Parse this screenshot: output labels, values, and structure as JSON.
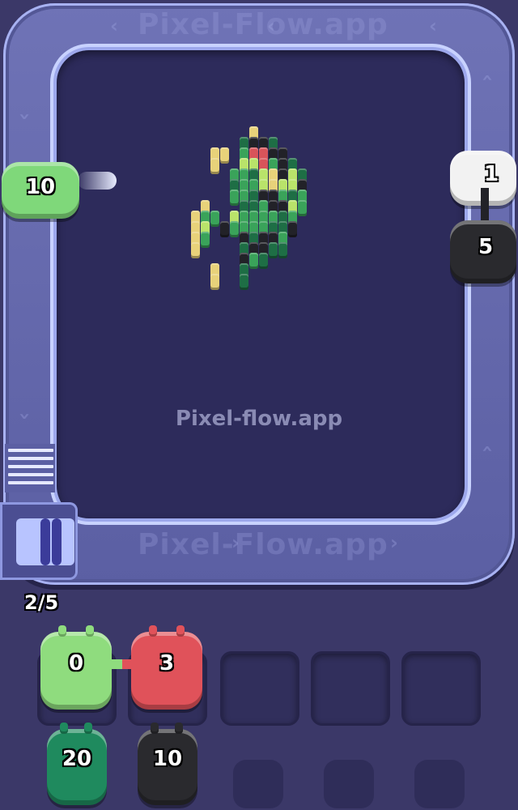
{
  "watermark": "Pixel-flow.app",
  "track_watermark_top": "Pixel-Flow.app",
  "track_watermark_bottom": "Pixel-Flow.app",
  "slot_counter": "2/5",
  "track_shooters": [
    {
      "count": "10",
      "color": "#7fd87a"
    },
    {
      "count": "1",
      "color": "#f2f2f2"
    },
    {
      "count": "5",
      "color": "#2a2a2e"
    }
  ],
  "slots": [
    {
      "count": "0",
      "color": "#8fdc7e"
    },
    {
      "count": "3",
      "color": "#e0525a"
    }
  ],
  "queue": [
    {
      "count": "20",
      "color": "#1f8a5e"
    },
    {
      "count": "10",
      "color": "#2a2a2e"
    }
  ],
  "colors": {
    "background": "#3b3868",
    "track": "#6f73b6",
    "board": "#2d2b5b",
    "pixel_green": "#3aa35a",
    "pixel_dark_green": "#1e6e45",
    "pixel_lime": "#b9e36a",
    "pixel_yellow": "#e8d27a",
    "pixel_red": "#d8545a",
    "pixel_black": "#222228"
  }
}
